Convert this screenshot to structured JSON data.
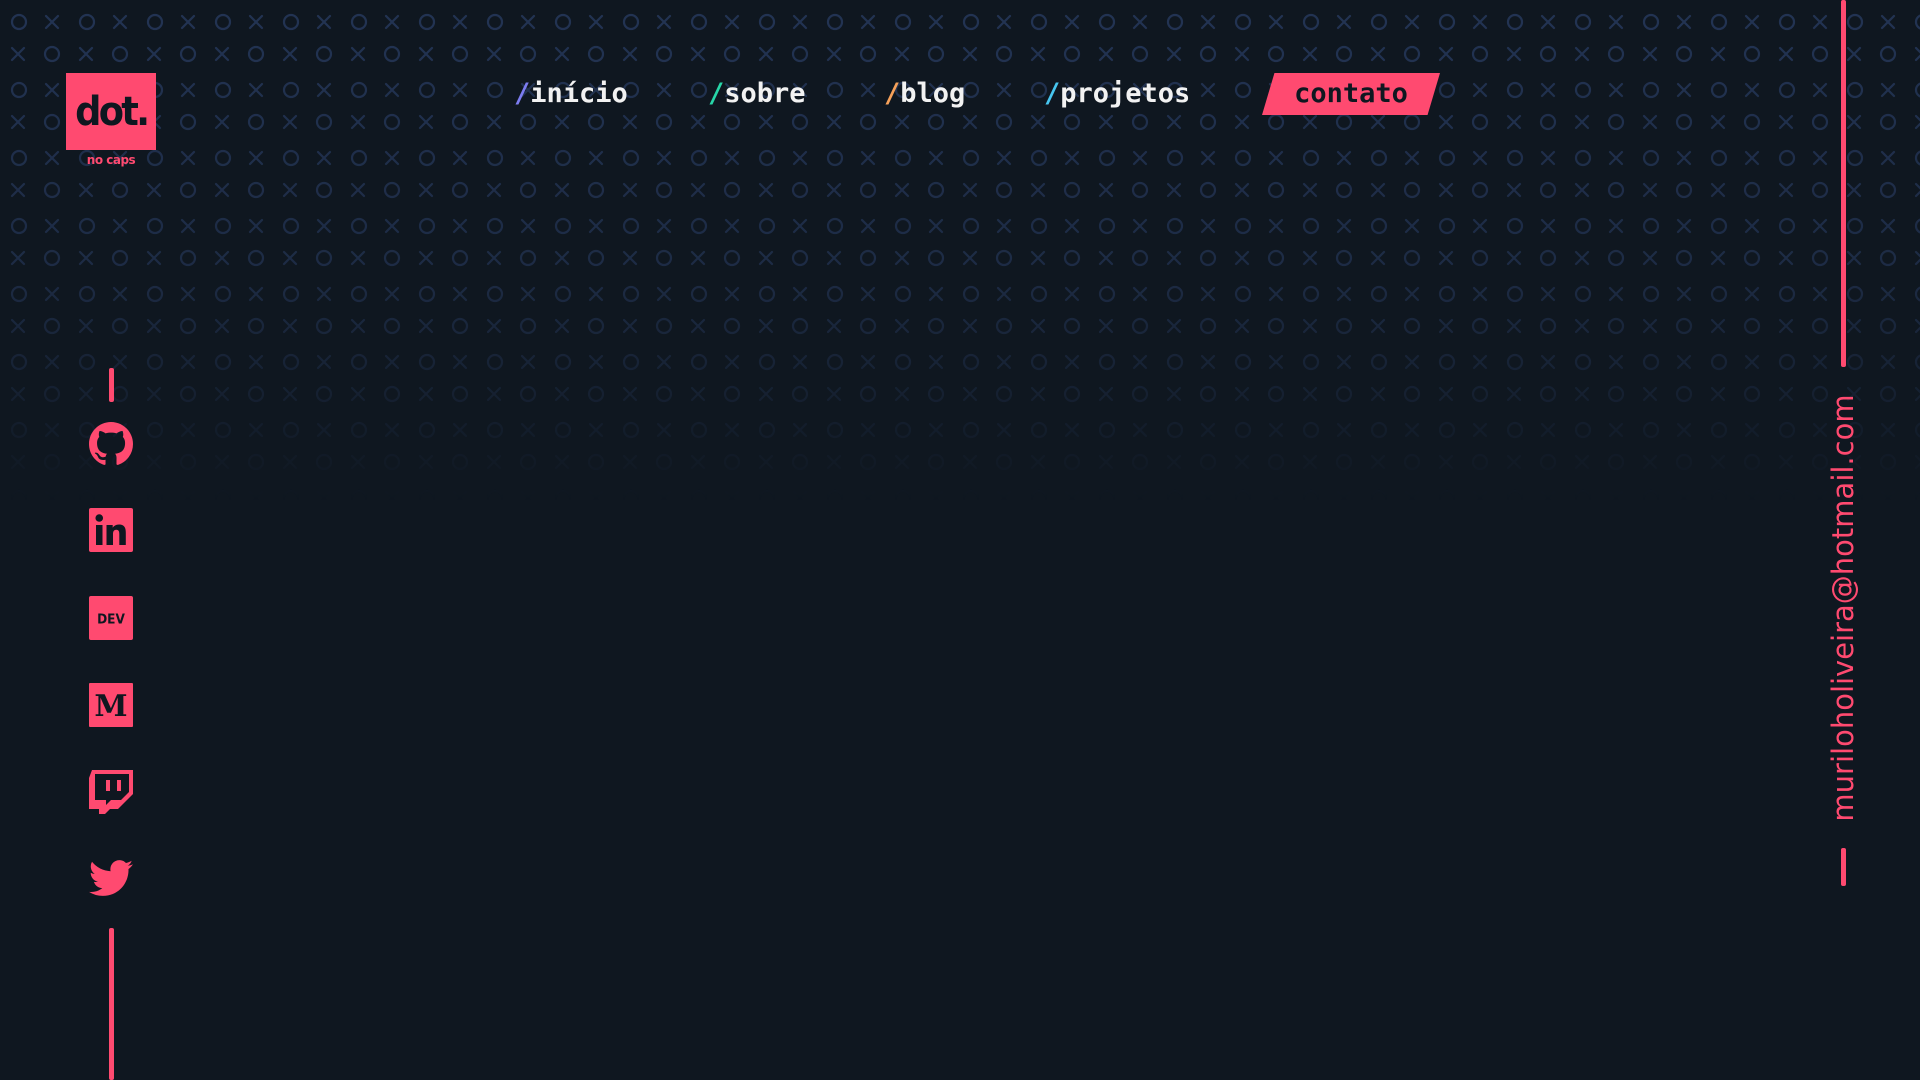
{
  "colors": {
    "background": "#0f1720",
    "accent": "#ff4a70",
    "pattern": "#233454",
    "nav_text": "#f2f2f2"
  },
  "logo": {
    "text": "dot.",
    "tagline": "no caps"
  },
  "nav": {
    "items": [
      {
        "slash": "/",
        "label": "início",
        "slash_color": "#7c7cf0"
      },
      {
        "slash": "/",
        "label": "sobre",
        "slash_color": "#27d6a8"
      },
      {
        "slash": "/",
        "label": "blog",
        "slash_color": "#f6a15a"
      },
      {
        "slash": "/",
        "label": "projetos",
        "slash_color": "#47c6f0"
      }
    ],
    "contact_label": "contato"
  },
  "social": [
    {
      "icon": "github-icon"
    },
    {
      "icon": "linkedin-icon"
    },
    {
      "icon": "dev-icon",
      "text": "DEV"
    },
    {
      "icon": "medium-icon",
      "text": "M"
    },
    {
      "icon": "twitch-icon"
    },
    {
      "icon": "twitter-icon"
    }
  ],
  "email": "muriloholiveira@hotmail.com"
}
